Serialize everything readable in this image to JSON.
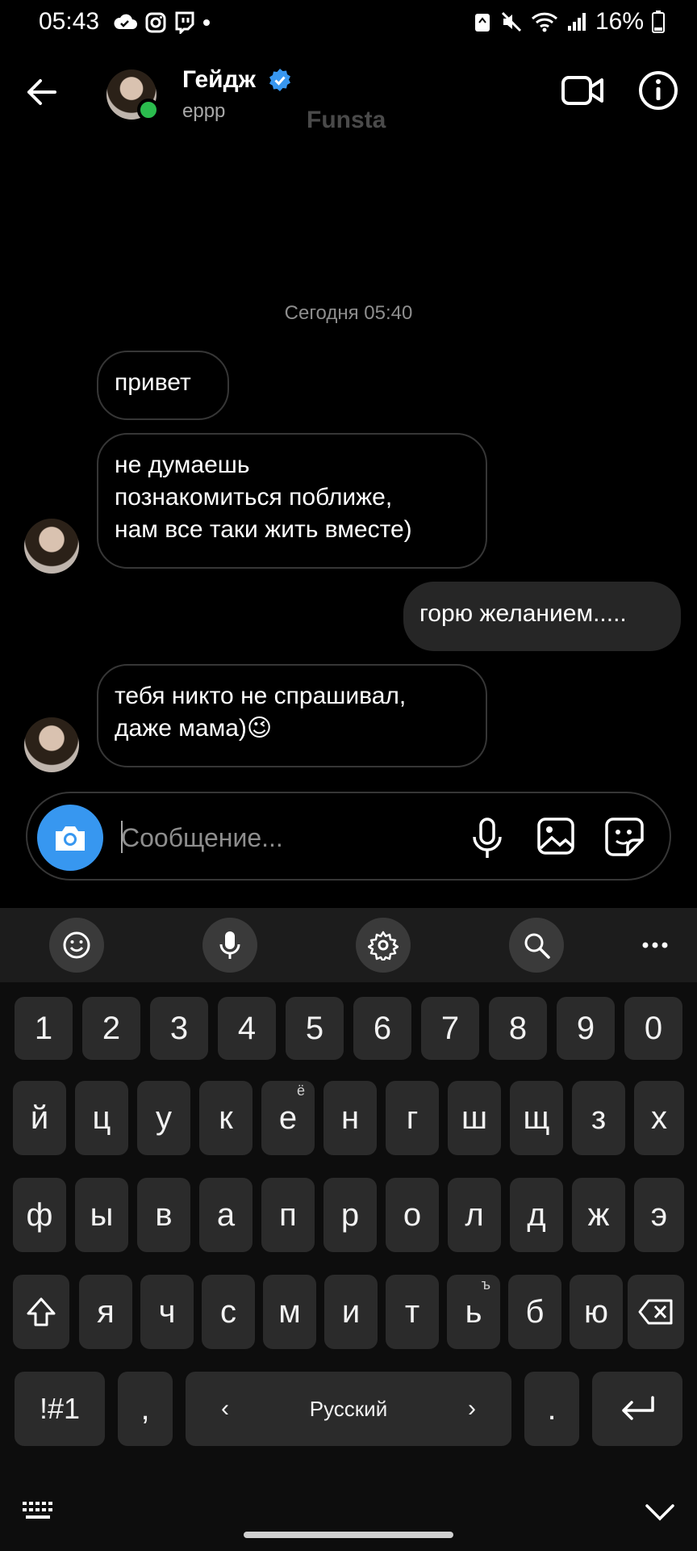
{
  "status": {
    "time": "05:43",
    "battery": "16%"
  },
  "header": {
    "name": "Гейдж",
    "username": "еррр",
    "account_label": "Funsta"
  },
  "chat": {
    "timestamp": "Сегодня 05:40",
    "messages": [
      {
        "side": "in",
        "text": "привет"
      },
      {
        "side": "in",
        "lines": [
          "не думаешь",
          "познакомиться поближе,",
          "нам все таки жить вместе)"
        ]
      },
      {
        "side": "out",
        "text": "горю желанием....."
      },
      {
        "side": "in",
        "lines": [
          "тебя никто не спрашивал,",
          "даже мама)😉"
        ]
      }
    ]
  },
  "composer": {
    "placeholder": "Сообщение..."
  },
  "keyboard": {
    "toolbar": [
      "emoji-icon",
      "microphone-icon",
      "settings-icon",
      "search-icon",
      "more-icon"
    ],
    "row_numbers": [
      "1",
      "2",
      "3",
      "4",
      "5",
      "6",
      "7",
      "8",
      "9",
      "0"
    ],
    "row1": [
      "й",
      "ц",
      "у",
      "к",
      "е",
      "н",
      "г",
      "ш",
      "щ",
      "з",
      "х"
    ],
    "row1_alt_e": "ё",
    "row2": [
      "ф",
      "ы",
      "в",
      "а",
      "п",
      "р",
      "о",
      "л",
      "д",
      "ж",
      "э"
    ],
    "row3": [
      "я",
      "ч",
      "с",
      "м",
      "и",
      "т",
      "ь",
      "б",
      "ю"
    ],
    "row3_alt_soft": "ъ",
    "symbols": "!#1",
    "comma": ",",
    "space": "Русский",
    "period": "."
  }
}
